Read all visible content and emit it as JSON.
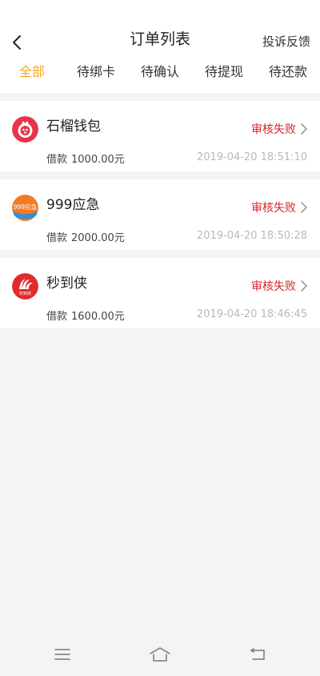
{
  "header": {
    "title": "订单列表",
    "feedback_label": "投诉反馈"
  },
  "tabs": [
    {
      "label": "全部",
      "active": true
    },
    {
      "label": "待绑卡",
      "active": false
    },
    {
      "label": "待确认",
      "active": false
    },
    {
      "label": "待提现",
      "active": false
    },
    {
      "label": "待还款",
      "active": false
    }
  ],
  "orders": [
    {
      "name": "石榴钱包",
      "status": "审核失败",
      "amount_label": "借款",
      "amount": "1000.00元",
      "time": "2019-04-20 18:51:10",
      "logo_icon": "pomegranate-icon"
    },
    {
      "name": "999应急",
      "status": "审核失败",
      "amount_label": "借款",
      "amount": "2000.00元",
      "time": "2019-04-20 18:50:28",
      "logo_icon": "999-emergency-logo",
      "logo_text": "999应急"
    },
    {
      "name": "秒到侠",
      "status": "审核失败",
      "amount_label": "借款",
      "amount": "1600.00元",
      "time": "2019-04-20 18:46:45",
      "logo_icon": "miaodaoxia-logo",
      "logo_text": "秒到侠"
    }
  ],
  "colors": {
    "accent": "#f4a51f",
    "status_fail": "#d6242a",
    "background": "#f4f4f4"
  }
}
